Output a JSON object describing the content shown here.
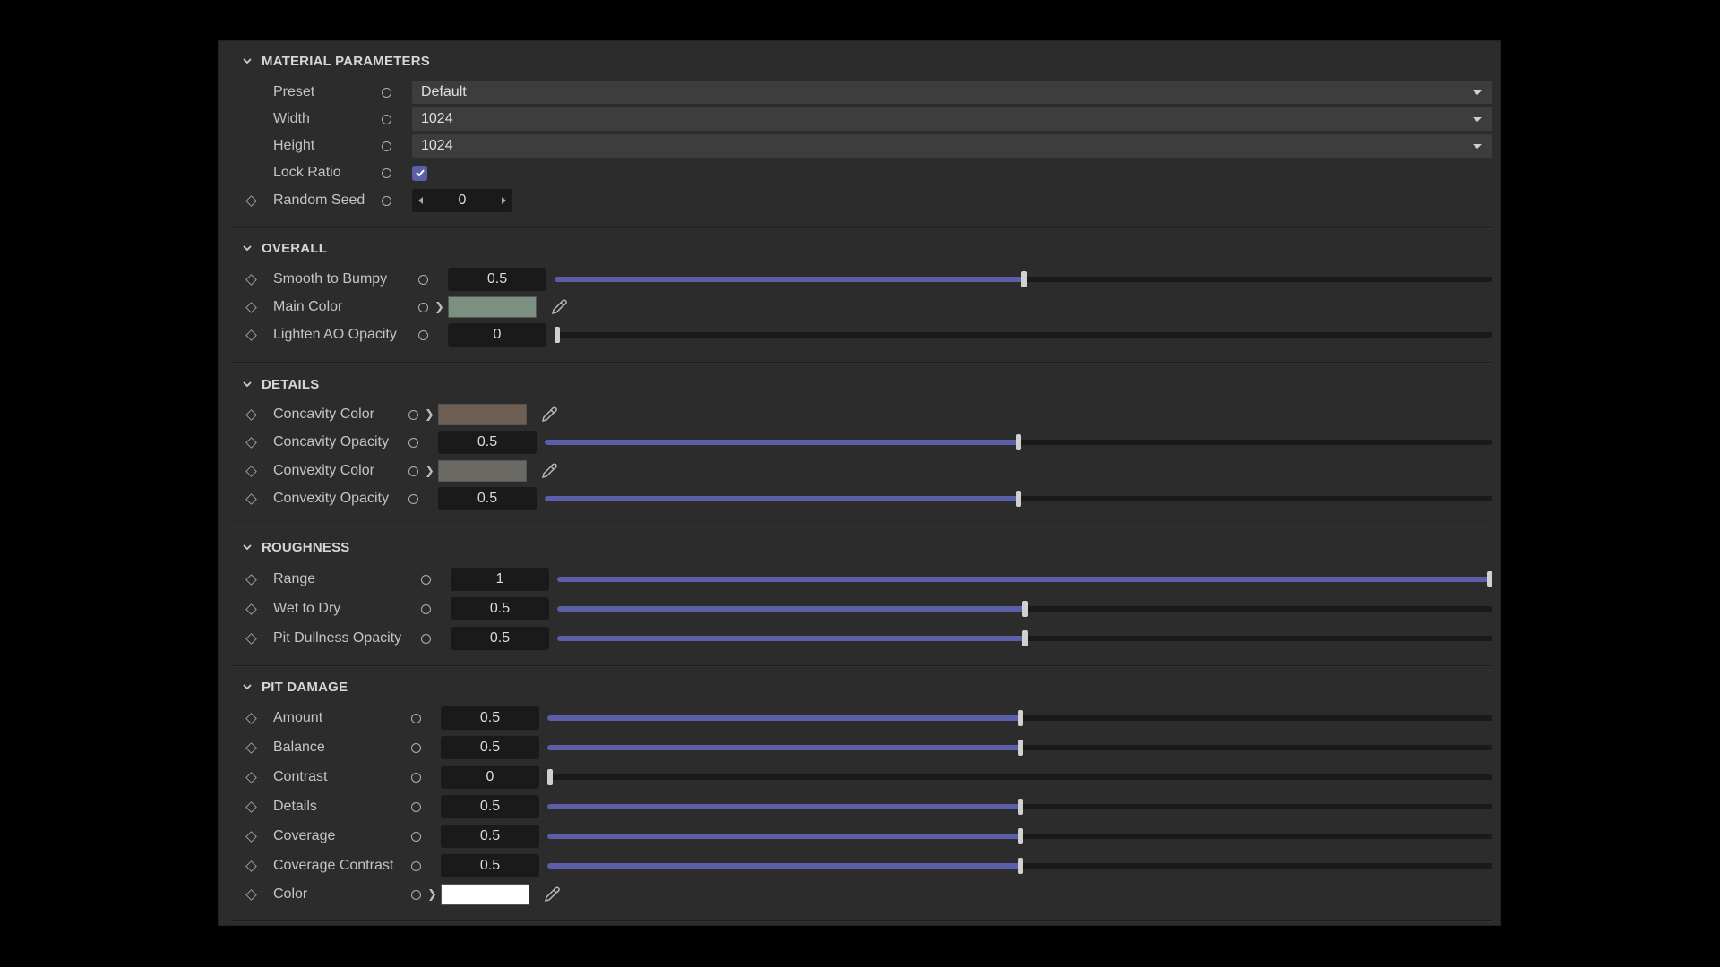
{
  "sections": {
    "material": {
      "title": "MATERIAL PARAMETERS",
      "preset": {
        "label": "Preset",
        "value": "Default"
      },
      "width": {
        "label": "Width",
        "value": "1024"
      },
      "height": {
        "label": "Height",
        "value": "1024"
      },
      "lock_ratio": {
        "label": "Lock Ratio",
        "checked": true
      },
      "random_seed": {
        "label": "Random Seed",
        "value": "0"
      }
    },
    "overall": {
      "title": "OVERALL",
      "smooth_to_bumpy": {
        "label": "Smooth to Bumpy",
        "value": "0.5",
        "fraction": 0.5
      },
      "main_color": {
        "label": "Main Color",
        "color": "#7a9080"
      },
      "lighten_ao_opacity": {
        "label": "Lighten AO Opacity",
        "value": "0",
        "fraction": 0
      }
    },
    "details": {
      "title": "DETAILS",
      "concavity_color": {
        "label": "Concavity Color",
        "color": "#6e5f54"
      },
      "concavity_opacity": {
        "label": "Concavity Opacity",
        "value": "0.5",
        "fraction": 0.5
      },
      "convexity_color": {
        "label": "Convexity Color",
        "color": "#6b6a65"
      },
      "convexity_opacity": {
        "label": "Convexity Opacity",
        "value": "0.5",
        "fraction": 0.5
      }
    },
    "roughness": {
      "title": "ROUGHNESS",
      "range": {
        "label": "Range",
        "value": "1",
        "fraction": 1
      },
      "wet_to_dry": {
        "label": "Wet to Dry",
        "value": "0.5",
        "fraction": 0.5
      },
      "pit_dullness_opacity": {
        "label": "Pit Dullness Opacity",
        "value": "0.5",
        "fraction": 0.5
      }
    },
    "pit_damage": {
      "title": "PIT DAMAGE",
      "amount": {
        "label": "Amount",
        "value": "0.5",
        "fraction": 0.5
      },
      "balance": {
        "label": "Balance",
        "value": "0.5",
        "fraction": 0.5
      },
      "contrast": {
        "label": "Contrast",
        "value": "0",
        "fraction": 0
      },
      "details": {
        "label": "Details",
        "value": "0.5",
        "fraction": 0.5
      },
      "coverage": {
        "label": "Coverage",
        "value": "0.5",
        "fraction": 0.5
      },
      "coverage_contrast": {
        "label": "Coverage Contrast",
        "value": "0.5",
        "fraction": 0.5
      },
      "color": {
        "label": "Color",
        "color": "#ffffff"
      }
    }
  },
  "colors": {
    "accent": "#5a5fa8",
    "panel_bg": "#2c2c2c",
    "field_bg": "#1a1a1a"
  }
}
